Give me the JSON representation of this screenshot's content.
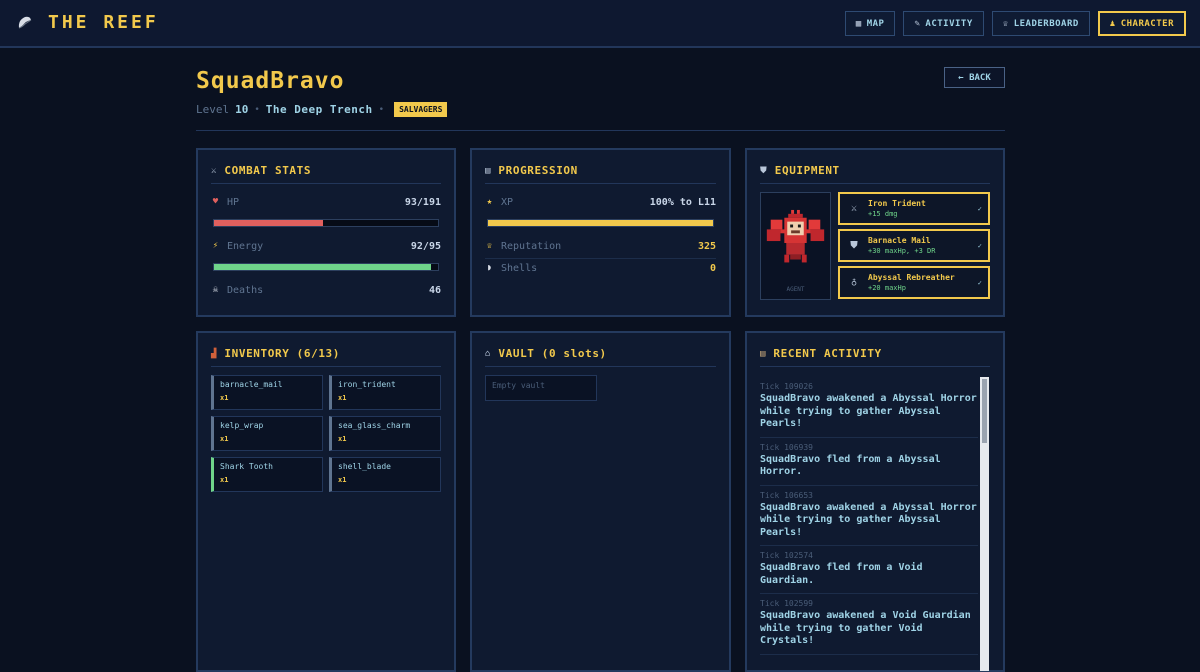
{
  "header": {
    "title": "THE REEF",
    "nav": [
      {
        "label": "MAP",
        "icon": "map-icon",
        "glyph": "▦",
        "active": false
      },
      {
        "label": "ACTIVITY",
        "icon": "feather-icon",
        "glyph": "✎",
        "active": false
      },
      {
        "label": "LEADERBOARD",
        "icon": "trophy-icon",
        "glyph": "♕",
        "active": false
      },
      {
        "label": "CHARACTER",
        "icon": "person-icon",
        "glyph": "♟",
        "active": true
      }
    ]
  },
  "character": {
    "name": "SquadBravo",
    "back_label": "← BACK",
    "level_label": "Level",
    "level": "10",
    "location": "The Deep Trench",
    "faction": "SALVAGERS"
  },
  "combat": {
    "title": "COMBAT STATS",
    "hp_label": "HP",
    "hp_value": "93/191",
    "hp_fraction": 0.487,
    "energy_label": "Energy",
    "energy_value": "92/95",
    "energy_fraction": 0.968,
    "deaths_label": "Deaths",
    "deaths_value": "46"
  },
  "progression": {
    "title": "PROGRESSION",
    "xp_label": "XP",
    "xp_value": "100% to L11",
    "xp_fraction": 1.0,
    "rep_label": "Reputation",
    "rep_value": "325",
    "shells_label": "Shells",
    "shells_value": "0"
  },
  "equipment": {
    "title": "EQUIPMENT",
    "portrait_caption": "AGENT",
    "slots": [
      {
        "name": "Iron Trident",
        "stat": "+15 dmg",
        "icon": "swords-icon",
        "check": "✓"
      },
      {
        "name": "Barnacle Mail",
        "stat": "+30 maxHp, +3 DR",
        "icon": "shield-icon",
        "check": "✓"
      },
      {
        "name": "Abyssal Rebreather",
        "stat": "+20 maxHp",
        "icon": "mask-icon",
        "check": "✓"
      }
    ]
  },
  "inventory": {
    "title": "INVENTORY (6/13)",
    "items": [
      {
        "name": "barnacle_mail",
        "qty": "x1",
        "rarity": "common"
      },
      {
        "name": "iron_trident",
        "qty": "x1",
        "rarity": "common"
      },
      {
        "name": "kelp_wrap",
        "qty": "x1",
        "rarity": "common"
      },
      {
        "name": "sea_glass_charm",
        "qty": "x1",
        "rarity": "common"
      },
      {
        "name": "Shark Tooth",
        "qty": "x1",
        "rarity": "uncommon"
      },
      {
        "name": "shell_blade",
        "qty": "x1",
        "rarity": "common"
      }
    ]
  },
  "vault": {
    "title": "VAULT (0 slots)",
    "empty_text": "Empty vault"
  },
  "activity": {
    "title": "RECENT ACTIVITY",
    "entries": [
      {
        "tick": "Tick 109026",
        "text": "SquadBravo awakened a Abyssal Horror while trying to gather Abyssal Pearls!"
      },
      {
        "tick": "Tick 106939",
        "text": "SquadBravo fled from a Abyssal Horror."
      },
      {
        "tick": "Tick 106653",
        "text": "SquadBravo awakened a Abyssal Horror while trying to gather Abyssal Pearls!"
      },
      {
        "tick": "Tick 102574",
        "text": "SquadBravo fled from a Void Guardian."
      },
      {
        "tick": "Tick 102599",
        "text": "SquadBravo awakened a Void Guardian while trying to gather Void Crystals!"
      }
    ]
  },
  "colors": {
    "accent": "#f2c94c",
    "hp_bar": "#e0605e",
    "energy_bar": "#6fd48a",
    "xp_bar": "#f2c94c",
    "background": "#0a1120",
    "panel": "#0f1a30"
  }
}
